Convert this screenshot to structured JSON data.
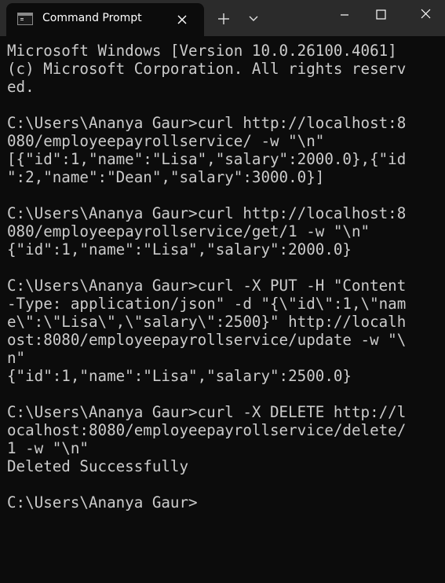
{
  "window": {
    "tab_title": "Command Prompt",
    "tab_icon": "command-prompt-icon",
    "close_tab_icon": "close-icon",
    "new_tab_icon": "plus-icon",
    "dropdown_icon": "chevron-down-icon",
    "minimize_icon": "minimize-icon",
    "maximize_icon": "maximize-icon",
    "close_window_icon": "close-icon"
  },
  "colors": {
    "background": "#0c0c0c",
    "titlebar": "#2b2b2b",
    "text": "#cccccc"
  },
  "terminal": {
    "lines": [
      "Microsoft Windows [Version 10.0.26100.4061]",
      "(c) Microsoft Corporation. All rights reserv",
      "ed.",
      "",
      "C:\\Users\\Ananya Gaur>curl http://localhost:8",
      "080/employeepayrollservice/ -w \"\\n\"",
      "[{\"id\":1,\"name\":\"Lisa\",\"salary\":2000.0},{\"id",
      "\":2,\"name\":\"Dean\",\"salary\":3000.0}]",
      "",
      "C:\\Users\\Ananya Gaur>curl http://localhost:8",
      "080/employeepayrollservice/get/1 -w \"\\n\"",
      "{\"id\":1,\"name\":\"Lisa\",\"salary\":2000.0}",
      "",
      "C:\\Users\\Ananya Gaur>curl -X PUT -H \"Content",
      "-Type: application/json\" -d \"{\\\"id\\\":1,\\\"nam",
      "e\\\":\\\"Lisa\\\",\\\"salary\\\":2500}\" http://localh",
      "ost:8080/employeepayrollservice/update -w \"\\",
      "n\"",
      "{\"id\":1,\"name\":\"Lisa\",\"salary\":2500.0}",
      "",
      "C:\\Users\\Ananya Gaur>curl -X DELETE http://l",
      "ocalhost:8080/employeepayrollservice/delete/",
      "1 -w \"\\n\"",
      "Deleted Successfully",
      "",
      "C:\\Users\\Ananya Gaur>"
    ]
  }
}
